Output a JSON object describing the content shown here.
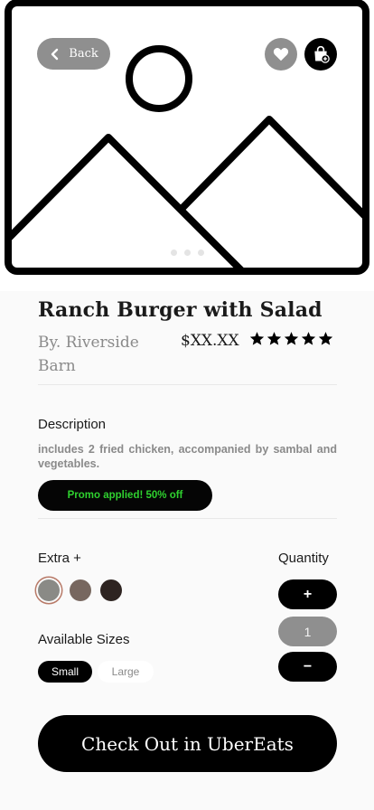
{
  "header": {
    "back_label": "Back"
  },
  "product": {
    "title": "Ranch Burger with Salad",
    "vendor": "By. Riverside Barn",
    "price": "$XX.XX",
    "rating": 5
  },
  "description": {
    "heading": "Description",
    "text": "includes 2 fried chicken, accompanied by sambal and vegetables.",
    "promo": "Promo applied! 50% off"
  },
  "extras": {
    "heading": "Extra +",
    "swatches": [
      {
        "color": "#8a8a86",
        "selected": true
      },
      {
        "color": "#77675f",
        "selected": false
      },
      {
        "color": "#2e2421",
        "selected": false
      }
    ]
  },
  "sizes": {
    "heading": "Available Sizes",
    "options": [
      "Small",
      "Large"
    ],
    "selected": "Small"
  },
  "quantity": {
    "heading": "Quantity",
    "plus": "+",
    "value": "1",
    "minus": "−"
  },
  "checkout": {
    "label": "Check Out in UberEats"
  },
  "carousel": {
    "count": 3,
    "active": 0
  },
  "colors": {
    "accent": "#000000",
    "promo_text": "#2fd12f",
    "muted": "#8a8a8a"
  }
}
